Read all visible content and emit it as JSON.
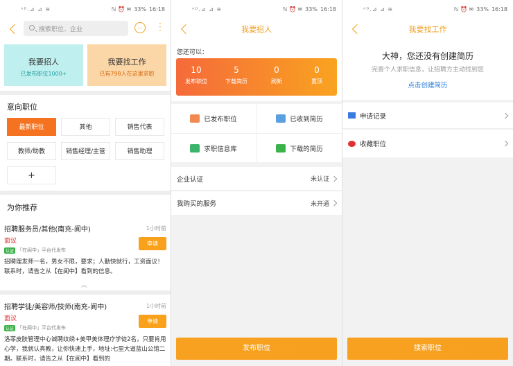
{
  "status": {
    "left": "ᴬᴰ.⊿ ⊿ ≋",
    "battery": "33%",
    "time": "16:18",
    "icons": "ℕ ⏰ ✉"
  },
  "s1": {
    "search_placeholder": "搜索职位、企业",
    "chat_icon": "…",
    "menu_icon": "⋮",
    "card_recruit": {
      "title": "我要招人",
      "sub": "已发布职位1000+"
    },
    "card_job": {
      "title": "我要找工作",
      "sub": "已有798人在这里求职"
    },
    "intent_title": "意向职位",
    "tags": [
      "最新职位",
      "其他",
      "销售代表",
      "教师/助教",
      "销售经理/主管",
      "销售助理",
      "+"
    ],
    "rec_title": "为你推荐",
    "jobs": [
      {
        "name": "招聘服务员/其他(南充-阆中)",
        "time": "1小时前",
        "salary": "面议",
        "badge": "认证",
        "meta": "「在阆中」平台代发布",
        "apply": "申请",
        "desc": "招聘理发师一名，男女不限，要求；人勤快就行，工资面议！ 联系时，请告之从【在阆中】看到的信息。"
      },
      {
        "name": "招聘学徒/美容师/技师(南充-阆中)",
        "time": "1小时前",
        "salary": "面议",
        "badge": "认证",
        "meta": "「在阆中」平台代发布",
        "apply": "申请",
        "desc": "洛菲皮肤管理中心诚聘纹绣+美甲美体理疗学徒2名，只要肯用心学，我就认真教，让你快速上手，地址:七里大道蓝山公馆二期。联系时，请告之从【在阆中】看到的"
      }
    ],
    "more": "︽"
  },
  "s2": {
    "title": "我要招人",
    "lead": "您还可以：",
    "stats": [
      {
        "value": "10",
        "label": "发布职位"
      },
      {
        "value": "5",
        "label": "下载简历"
      },
      {
        "value": "0",
        "label": "刷新"
      },
      {
        "value": "0",
        "label": "置顶"
      }
    ],
    "grid": [
      "已发布职位",
      "已收到简历",
      "求职信息库",
      "下载的简历"
    ],
    "rows": [
      {
        "label": "企业认证",
        "value": "未认证"
      },
      {
        "label": "我购买的服务",
        "value": "未开通"
      }
    ],
    "button": "发布职位"
  },
  "s3": {
    "title": "我要找工作",
    "empty_title": "大神，您还没有创建简历",
    "empty_sub": "完善个人求职信息，让招聘方主动找到您",
    "empty_link": "点击创建简历",
    "rows": [
      "申请记录",
      "收藏职位"
    ],
    "button": "搜索职位"
  },
  "colors": {
    "accent": "#f0a020",
    "orange": "#f57320",
    "link": "#2b7cd8",
    "salary": "#e03030"
  }
}
